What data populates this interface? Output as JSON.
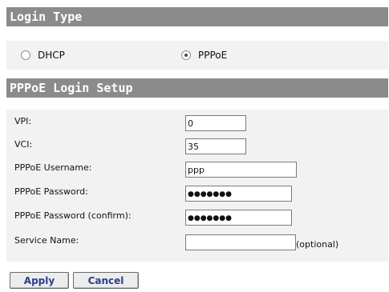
{
  "login_type": {
    "title": "Login Type",
    "options": [
      {
        "label": "DHCP",
        "checked": false
      },
      {
        "label": "PPPoE",
        "checked": true
      }
    ]
  },
  "pppoe": {
    "title": "PPPoE Login Setup",
    "fields": [
      {
        "label": "VPI:",
        "value": "0"
      },
      {
        "label": "VCI:",
        "value": "35"
      },
      {
        "label": "PPPoE Username:",
        "value": "ppp"
      },
      {
        "label": "PPPoE Password:",
        "value": "●●●●●●●"
      },
      {
        "label": "PPPoE Password (confirm):",
        "value": "●●●●●●●"
      },
      {
        "label": "Service Name:",
        "value": ""
      }
    ],
    "optional_note": "(optional)"
  },
  "buttons": {
    "apply": "Apply",
    "cancel": "Cancel"
  }
}
